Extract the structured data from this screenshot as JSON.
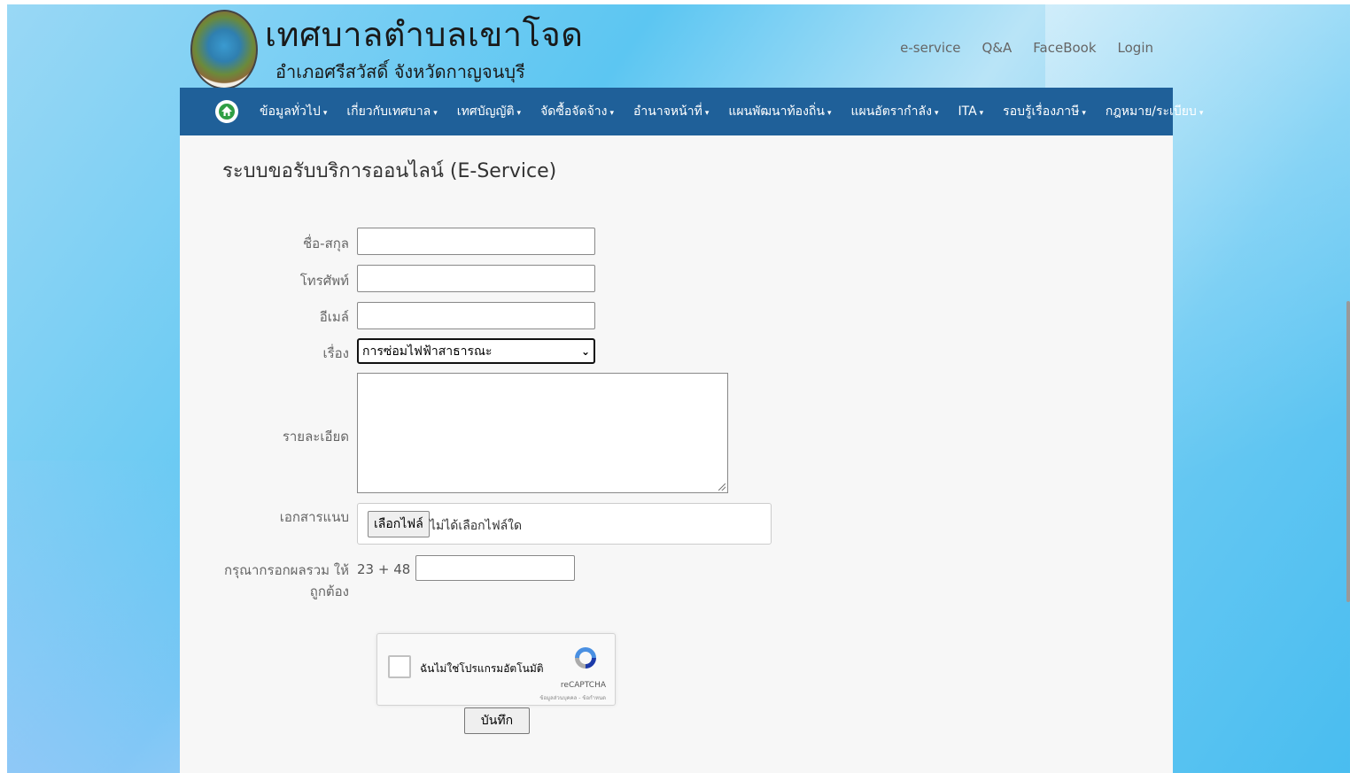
{
  "header": {
    "site_title": "เทศบาลตำบลเขาโจด",
    "site_subtitle": "อำเภอศรีสวัสดิ์  จังหวัดกาญจนบุรี",
    "top_links": [
      "e-service",
      "Q&A",
      "FaceBook",
      "Login"
    ]
  },
  "nav": {
    "items": [
      {
        "label": "ข้อมูลทั่วไป"
      },
      {
        "label": "เกี่ยวกับเทศบาล"
      },
      {
        "label": "เทศบัญญัติ"
      },
      {
        "label": "จัดซื้อจัดจ้าง"
      },
      {
        "label": "อำนาจหน้าที่"
      },
      {
        "label": "แผนพัฒนาท้องถิ่น"
      },
      {
        "label": "แผนอัตรากำลัง"
      },
      {
        "label": "ITA"
      },
      {
        "label": "รอบรู้เรื่องภาษี"
      },
      {
        "label": "กฎหมาย/ระเบียบ"
      }
    ],
    "caret": "▾"
  },
  "page": {
    "title": "ระบบขอรับบริการออนไลน์ (E-Service)"
  },
  "form": {
    "name_label": "ชื่อ-สกุล",
    "phone_label": "โทรศัพท์",
    "email_label": "อีเมล์",
    "subject_label": "เรื่อง",
    "subject_value": "การซ่อมไฟฟ้าสาธารณะ",
    "detail_label": "รายละเอียด",
    "attachment_label": "เอกสารแนบ",
    "file_button": "เลือกไฟล์",
    "file_status": "ไม่ได้เลือกไฟล์ใด",
    "sum_label_line1": "กรุณากรอกผลรวม ให้",
    "sum_label_line2": "ถูกต้อง",
    "sum_question": "23 + 48 =",
    "save_button": "บันทึก"
  },
  "captcha": {
    "text": "ฉันไม่ใช่โปรแกรมอัตโนมัติ",
    "brand": "reCAPTCHA",
    "links": "ข้อมูลส่วนบุคคล - ข้อกำหนด"
  },
  "colors": {
    "navbar": "#1f6099",
    "home_icon": "#2f9e44"
  }
}
